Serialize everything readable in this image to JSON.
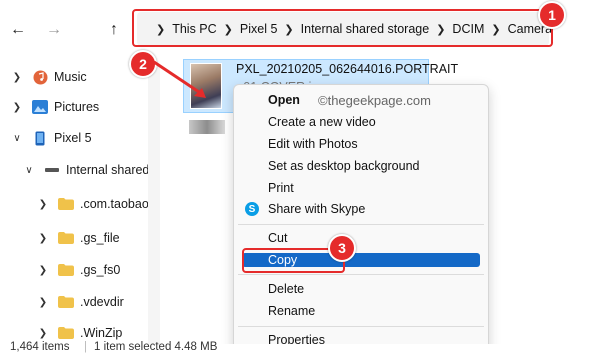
{
  "toolbar": {
    "back_glyph": "←",
    "forward_glyph": "→",
    "up_glyph": "↑",
    "breadcrumbs": [
      "This PC",
      "Pixel 5",
      "Internal shared storage",
      "DCIM",
      "Camera"
    ]
  },
  "sidebar": {
    "items": [
      {
        "label": "Music",
        "icon": "music-icon"
      },
      {
        "label": "Pictures",
        "icon": "pictures-icon"
      },
      {
        "label": "Pixel 5",
        "icon": "phone-icon"
      },
      {
        "label": "Internal shared",
        "icon": "drive-icon"
      },
      {
        "label": ".com.taobao.t",
        "icon": "folder-icon"
      },
      {
        "label": ".gs_file",
        "icon": "folder-icon"
      },
      {
        "label": ".gs_fs0",
        "icon": "folder-icon"
      },
      {
        "label": ".vdevdir",
        "icon": "folder-icon"
      },
      {
        "label": ".WinZip",
        "icon": "folder-icon"
      }
    ]
  },
  "file": {
    "name_line1": "PXL_20210205_062644016.PORTRAIT",
    "name_line2": "~01.COVER.jpg"
  },
  "context_menu": {
    "watermark": "©thegeekpage.com",
    "items": {
      "open": "Open",
      "new_video": "Create a new video",
      "edit_photos": "Edit with Photos",
      "desktop_bg": "Set as desktop background",
      "print": "Print",
      "skype": "Share with Skype",
      "cut": "Cut",
      "copy": "Copy",
      "delete": "Delete",
      "rename": "Rename",
      "properties": "Properties"
    }
  },
  "status": {
    "items_count": "1,464 items",
    "selection": "1 item selected  4.48 MB"
  },
  "annotations": {
    "badge1": "1",
    "badge2": "2",
    "badge3": "3",
    "color": "#e52b2b"
  },
  "colors": {
    "selection_bg": "#cce8ff",
    "menu_highlight": "#1469c7",
    "folder": "#f0c24a"
  }
}
